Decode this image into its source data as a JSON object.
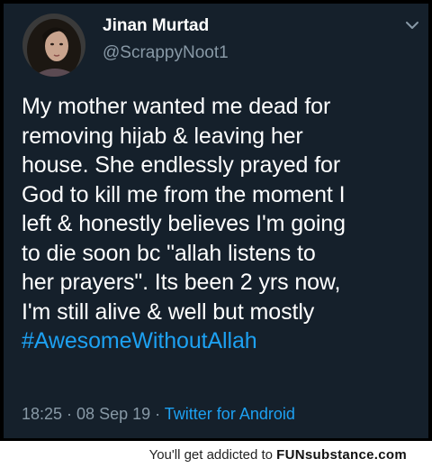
{
  "tweet": {
    "display_name": "Jinan Murtad",
    "handle": "@ScrappyNoot1",
    "menu_icon": "chevron-down-icon",
    "body_lines": [
      "My mother wanted me dead for",
      "removing hijab & leaving her",
      "house. She endlessly prayed for",
      "God to kill me from the moment I",
      "left & honestly believes I'm going",
      "to die soon bc \"allah listens to",
      "her prayers\". Its been 2 yrs now,",
      "I'm still alive & well but mostly"
    ],
    "hashtag": "#AwesomeWithoutAllah",
    "timestamp": "18:25 · 08 Sep 19 · ",
    "source": "Twitter for Android"
  },
  "footer": {
    "prefix": "You'll get addicted to ",
    "brand": "FUNsubstance.com"
  },
  "colors": {
    "card_background": "#15202b",
    "link_blue": "#1da1f2",
    "muted_text": "#8899a6"
  }
}
